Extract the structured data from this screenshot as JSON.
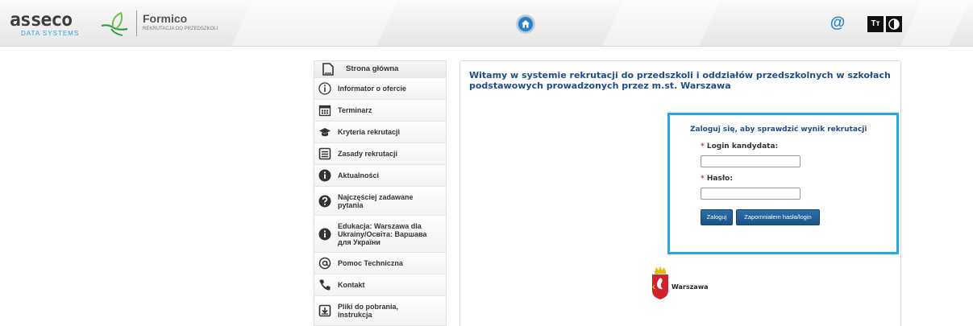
{
  "header": {
    "asseco_word": "asseco",
    "asseco_sub": "DATA SYSTEMS",
    "app_name": "Formico",
    "app_sub": "REKRUTACJA DO PRZEDSZKOLI",
    "at_symbol": "@",
    "font_size_label": "Tт",
    "accent_color": "#2b7fc3"
  },
  "menu": {
    "items": [
      {
        "label": "Strona główna",
        "icon": "page-icon"
      },
      {
        "label": "Informator o ofercie",
        "icon": "info-outline-icon"
      },
      {
        "label": "Terminarz",
        "icon": "calendar-icon"
      },
      {
        "label": "Kryteria rekrutacji",
        "icon": "graduation-cap-icon"
      },
      {
        "label": "Zasady rekrutacji",
        "icon": "list-icon"
      },
      {
        "label": "Aktualności",
        "icon": "info-icon"
      },
      {
        "label": "Najczęściej zadawane pytania",
        "icon": "question-icon"
      },
      {
        "label": "Edukacja: Warszawa dla Ukrainy/Освіта: Варшава для України",
        "icon": "info-icon"
      },
      {
        "label": "Pomoc Techniczna",
        "icon": "at-icon"
      },
      {
        "label": "Kontakt",
        "icon": "phone-icon"
      },
      {
        "label": "Pliki do pobrania, instrukcja",
        "icon": "download-icon"
      }
    ]
  },
  "main": {
    "welcome": "Witamy w systemie rekrutacji do przedszkoli i oddziałów przedszkolnych w szkołach podstawowych prowadzonych przez m.st. Warszawa",
    "login": {
      "title": "Zaloguj się, aby sprawdzić wynik rekrutacji",
      "required_mark": "*",
      "login_label": "Login kandydata:",
      "login_value": "",
      "password_label": "Hasło:",
      "password_value": "",
      "submit_label": "Zaloguj",
      "forgot_label": "Zapomniałem hasła/login"
    },
    "city_logo_text": "Warszawa"
  }
}
